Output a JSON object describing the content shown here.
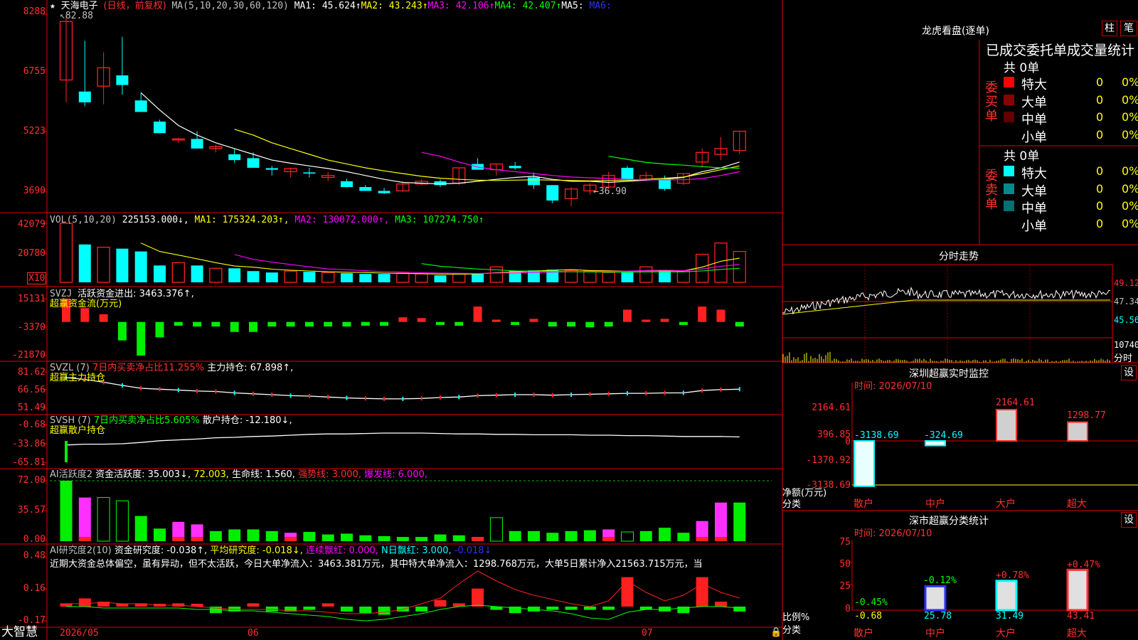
{
  "stock": {
    "star": "★",
    "name": "天海电子",
    "mode": "(日线，前复权)",
    "ma_params": "MA(5,10,20,30,60,120)",
    "ma1": "MA1: 45.624↑",
    "ma2": "MA2: 43.243↑",
    "ma3": "MA3: 42.106↑",
    "ma4": "MA4: 42.407↑",
    "ma5": "MA5:",
    "ma6": "MA6:",
    "high_mark": "82.88",
    "low_mark": "36.90"
  },
  "colors": {
    "up": "#ff2020",
    "down": "#00ffff",
    "grid": "#ff0000",
    "ma1": "#ffffff",
    "ma2": "#ffff00",
    "ma3": "#ff00ff",
    "ma4": "#00ff00"
  },
  "price_axis": [
    "8288",
    "6755",
    "5223",
    "3690"
  ],
  "vol_axis": [
    "42079",
    "20780",
    "X10"
  ],
  "svzj_axis": [
    "15131",
    "-3370",
    "-21870"
  ],
  "svzl_axis": [
    "81.62",
    "66.56",
    "51.49"
  ],
  "svsh_axis": [
    "-0.68",
    "-33.86",
    "-65.81"
  ],
  "huoyue_axis": [
    "72.00",
    "35.57",
    "0.00"
  ],
  "yanjiu_axis": [
    "0.48",
    "0.16",
    "-0.17"
  ],
  "panels": {
    "vol": {
      "name": "VOL(5,10,20)",
      "val": "225153.000↓,",
      "ma1": "MA1: 175324.203↑,",
      "ma2": "MA2: 130072.000↑,",
      "ma3": "MA3: 107274.750↑"
    },
    "svzj": {
      "name": "SVZJ",
      "line": "活跃资金进出: 3463.376↑,",
      "sub": "超赢资金流(万元)"
    },
    "svzl": {
      "name": "SVZL (7)",
      "ratio": "7日内买卖净占比11.255%",
      "hold": "主力持仓: 67.898↑,",
      "sub": "超赢主力持仓"
    },
    "svsh": {
      "name": "SVSH (7)",
      "ratio": "7日内买卖净占比5.605%",
      "hold": "散户持仓: -12.180↓,",
      "sub": "超赢散户持仓"
    },
    "huoyue": {
      "name": "AI活跃度2",
      "a": "资金活跃度: 35.003↓,",
      "b": "72.003,",
      "c": "生命线: 1.560,",
      "d": "强势线: 3.000,",
      "e": "爆发线: 6.000,"
    },
    "yanjiu": {
      "name": "AI研究度2(10)",
      "a": "资金研究度: -0.038↑,",
      "b": "平均研究度: -0.018↓,",
      "c": "连续飘红: 0.000,",
      "d": "N日飘红: 3.000,",
      "e": "-0.018↓",
      "comment": "近期大资金总体偏空，虽有异动，但不太活跃，今日大单净流入：3463.381万元，其中特大单净流入：1298.768万元，大单5日累计净入21563.715万元，当"
    }
  },
  "date_axis": {
    "brand": "大智慧",
    "d1": "2026/05",
    "d2": "06",
    "d3": "07"
  },
  "chart_data": {
    "type": "candlestick",
    "price_ylim": [
      3690,
      8288
    ],
    "candles_ohlc": [
      [
        6580,
        8288,
        6000,
        8100
      ],
      [
        6280,
        7600,
        5900,
        6000
      ],
      [
        6420,
        7300,
        5950,
        6900
      ],
      [
        6700,
        7700,
        6200,
        6450
      ],
      [
        6050,
        6250,
        5800,
        5750
      ],
      [
        5500,
        5550,
        5200,
        5200
      ],
      [
        5050,
        5080,
        4950,
        5050
      ],
      [
        5050,
        5250,
        4850,
        4800
      ],
      [
        4800,
        4900,
        4700,
        4850
      ],
      [
        4650,
        4800,
        4430,
        4500
      ],
      [
        4550,
        4700,
        4350,
        4300
      ],
      [
        4290,
        4350,
        4100,
        4250
      ],
      [
        4200,
        4300,
        4050,
        4280
      ],
      [
        4180,
        4300,
        4050,
        4150
      ],
      [
        4050,
        4200,
        3950,
        4100
      ],
      [
        3950,
        4020,
        3790,
        3800
      ],
      [
        3800,
        3850,
        3700,
        3700
      ],
      [
        3700,
        3780,
        3620,
        3640
      ],
      [
        3700,
        3950,
        3680,
        3880
      ],
      [
        3880,
        4000,
        3850,
        3950
      ],
      [
        3950,
        4000,
        3800,
        3850
      ],
      [
        3900,
        4300,
        3850,
        4300
      ],
      [
        4400,
        4550,
        4250,
        4250
      ],
      [
        4250,
        4400,
        4100,
        4400
      ],
      [
        4350,
        4450,
        4250,
        4290
      ],
      [
        4050,
        4180,
        3750,
        3850
      ],
      [
        3850,
        3850,
        3380,
        3450
      ],
      [
        3500,
        3800,
        3300,
        3750
      ],
      [
        3700,
        3900,
        3600,
        3850
      ],
      [
        3800,
        4200,
        3750,
        4100
      ],
      [
        4300,
        4350,
        4000,
        4000
      ],
      [
        4000,
        4200,
        3950,
        4100
      ],
      [
        4000,
        4100,
        3700,
        3750
      ],
      [
        3900,
        4150,
        3850,
        4150
      ],
      [
        4450,
        4800,
        4300,
        4700
      ],
      [
        4650,
        5100,
        4500,
        4800
      ],
      [
        4750,
        5250,
        4650,
        5250
      ]
    ],
    "ma_series": [
      {
        "name": "MA1",
        "values": [
          null,
          null,
          null,
          null,
          6250,
          5800,
          5400,
          5150,
          4950,
          4800,
          4650,
          4500,
          4420,
          4350,
          4280,
          4200,
          4100,
          4000,
          3920,
          3900,
          3880,
          3900,
          3950,
          4000,
          4050,
          4080,
          4000,
          3950,
          3950,
          3920,
          3950,
          3980,
          4000,
          4050,
          4200,
          4300,
          4450
        ]
      },
      {
        "name": "MA2",
        "values": [
          null,
          null,
          null,
          null,
          null,
          null,
          null,
          null,
          null,
          5300,
          5150,
          4950,
          4800,
          4650,
          4500,
          4400,
          4300,
          4220,
          4150,
          4080,
          4030,
          4000,
          3980,
          3970,
          3980,
          3990,
          3980,
          3970,
          3960,
          3970,
          3980,
          4000,
          4030,
          4060,
          4150,
          4250,
          4350
        ]
      },
      {
        "name": "MA3",
        "values": [
          null,
          null,
          null,
          null,
          null,
          null,
          null,
          null,
          null,
          null,
          null,
          null,
          null,
          null,
          null,
          null,
          null,
          null,
          null,
          4700,
          4600,
          4450,
          4320,
          4250,
          4200,
          4150,
          4100,
          4060,
          4040,
          4020,
          4000,
          3990,
          3990,
          3990,
          4020,
          4100,
          4200
        ]
      },
      {
        "name": "MA4",
        "values": [
          null,
          null,
          null,
          null,
          null,
          null,
          null,
          null,
          null,
          null,
          null,
          null,
          null,
          null,
          null,
          null,
          null,
          null,
          null,
          null,
          null,
          null,
          null,
          null,
          null,
          null,
          null,
          null,
          null,
          4600,
          4520,
          4440,
          4400,
          4370,
          4330,
          4300,
          4290
        ]
      }
    ],
    "volume_ylim": [
      0,
      42079
    ],
    "volumes": [
      42079,
      27000,
      25000,
      24000,
      22000,
      12000,
      14000,
      12000,
      10000,
      10000,
      8000,
      7000,
      8000,
      7500,
      7000,
      6500,
      6000,
      6000,
      6500,
      6000,
      5000,
      6000,
      6500,
      11000,
      8000,
      8500,
      9000,
      8500,
      8000,
      7000,
      7000,
      11000,
      8000,
      8000,
      20000,
      28000,
      22000
    ],
    "svzj_ylim": [
      -21870,
      15131
    ],
    "svzj": [
      15131,
      9000,
      5000,
      -12000,
      -21870,
      -10000,
      -2500,
      -3000,
      -3000,
      -6500,
      -6500,
      -3000,
      -3000,
      -3000,
      -3000,
      -3000,
      -2500,
      -2500,
      3000,
      2500,
      -2000,
      -2500,
      10000,
      1500,
      -2000,
      2000,
      -3000,
      -3000,
      -3500,
      -3000,
      8000,
      1500,
      2000,
      -2000,
      10000,
      8000,
      -3000,
      3463
    ]
  },
  "right_panel": {
    "lhkp": {
      "title": "龙虎看盘(逐单)",
      "btn1": "柱",
      "btn2": "笔",
      "table_title": "已成交委托单成交量统计",
      "buy_label": "委买单",
      "sell_label": "委卖单",
      "buy_total": "共 0单",
      "sell_total": "共 0单",
      "rows": [
        {
          "label": "特大",
          "count": "0",
          "pct": "0%"
        },
        {
          "label": "大单",
          "count": "0",
          "pct": "0%"
        },
        {
          "label": "中单",
          "count": "0",
          "pct": "0%"
        },
        {
          "label": "小单",
          "count": "0",
          "pct": "0%"
        }
      ]
    },
    "fenshi": {
      "title": "分时走势",
      "p1": "49.12",
      "p2": "47.34",
      "p3": "45.56",
      "vol": "10740",
      "unit": "分时"
    },
    "jiankong": {
      "title": "深圳超赢实时监控",
      "btn": "设",
      "time": "时间: 2026/07/10",
      "axis": [
        "2164.61",
        "396.85",
        "0",
        "-1370.92",
        "-3138.69"
      ],
      "bars": [
        {
          "name": "散户",
          "value": -3138.69,
          "label": "-3138.69"
        },
        {
          "name": "中户",
          "value": -324.69,
          "label": "-324.69"
        },
        {
          "name": "大户",
          "value": 2164.61,
          "label": "2164.61"
        },
        {
          "name": "超大",
          "value": 1298.77,
          "label": "1298.77"
        }
      ],
      "ylabel1": "净额(万元)",
      "ylabel2": "分类"
    },
    "fenlei": {
      "title": "深市超赢分类统计",
      "btn": "设",
      "time": "时间: 2026/07/10",
      "axis": [
        "75",
        "50",
        "25",
        "0"
      ],
      "bars": [
        {
          "name": "散户",
          "value": 0,
          "pct": "-0.45%",
          "bottom": "-0.68"
        },
        {
          "name": "中户",
          "value": 25.78,
          "pct": "-0.12%",
          "bottom": "25.78"
        },
        {
          "name": "大户",
          "value": 31.49,
          "pct": "+0.78%",
          "bottom": "31.49"
        },
        {
          "name": "超大",
          "value": 43.41,
          "pct": "+0.47%",
          "bottom": "43.41"
        }
      ],
      "ylabel1": "比例%",
      "ylabel2": "分类"
    }
  }
}
